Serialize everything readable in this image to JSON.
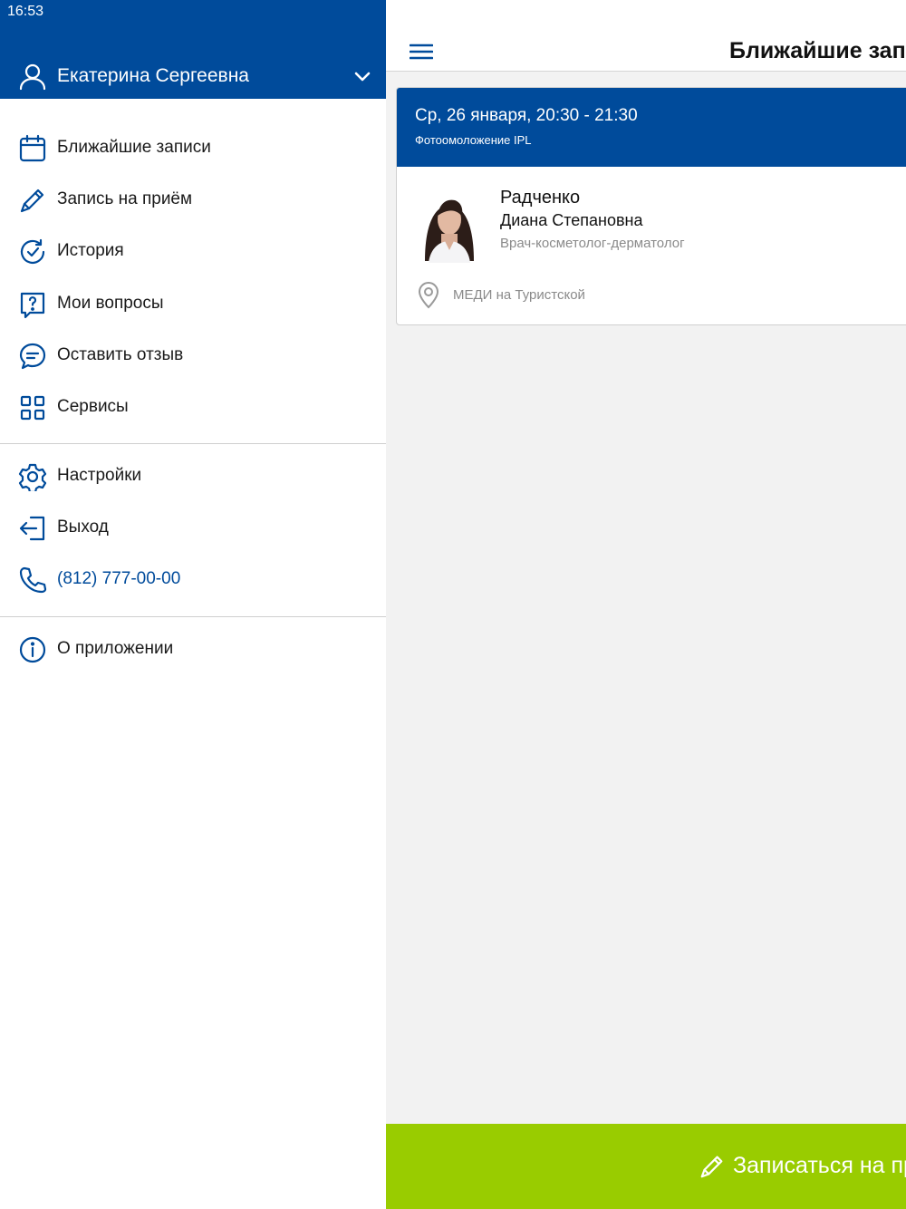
{
  "status_bar": {
    "time": "16:53"
  },
  "user": {
    "name": "Екатерина Сергеевна"
  },
  "menu": {
    "items": [
      {
        "label": "Ближайшие записи",
        "icon": "calendar-icon"
      },
      {
        "label": "Запись на приём",
        "icon": "pen-icon"
      },
      {
        "label": "История",
        "icon": "history-icon"
      },
      {
        "label": "Мои вопросы",
        "icon": "question-icon"
      },
      {
        "label": "Оставить отзыв",
        "icon": "chat-icon"
      },
      {
        "label": "Сервисы",
        "icon": "grid-icon"
      }
    ],
    "secondary": [
      {
        "label": "Настройки",
        "icon": "gear-icon"
      },
      {
        "label": "Выход",
        "icon": "logout-icon"
      },
      {
        "label": "(812) 777-00-00",
        "icon": "phone-icon"
      }
    ],
    "about": {
      "label": "О приложении",
      "icon": "info-icon"
    }
  },
  "header": {
    "title": "Ближайшие записи"
  },
  "appointment": {
    "datetime": "Ср, 26 января, 20:30 - 21:30",
    "service": "Фотоомоложение IPL",
    "doctor_surname": "Радченко",
    "doctor_name": "Диана Степановна",
    "specialty": "Врач-косметолог-дерматолог",
    "clinic": "МЕДИ на Туристской"
  },
  "cta": {
    "label": "Записаться на приём"
  },
  "colors": {
    "brand_blue": "#004b9b",
    "cta_green": "#99cc00"
  }
}
